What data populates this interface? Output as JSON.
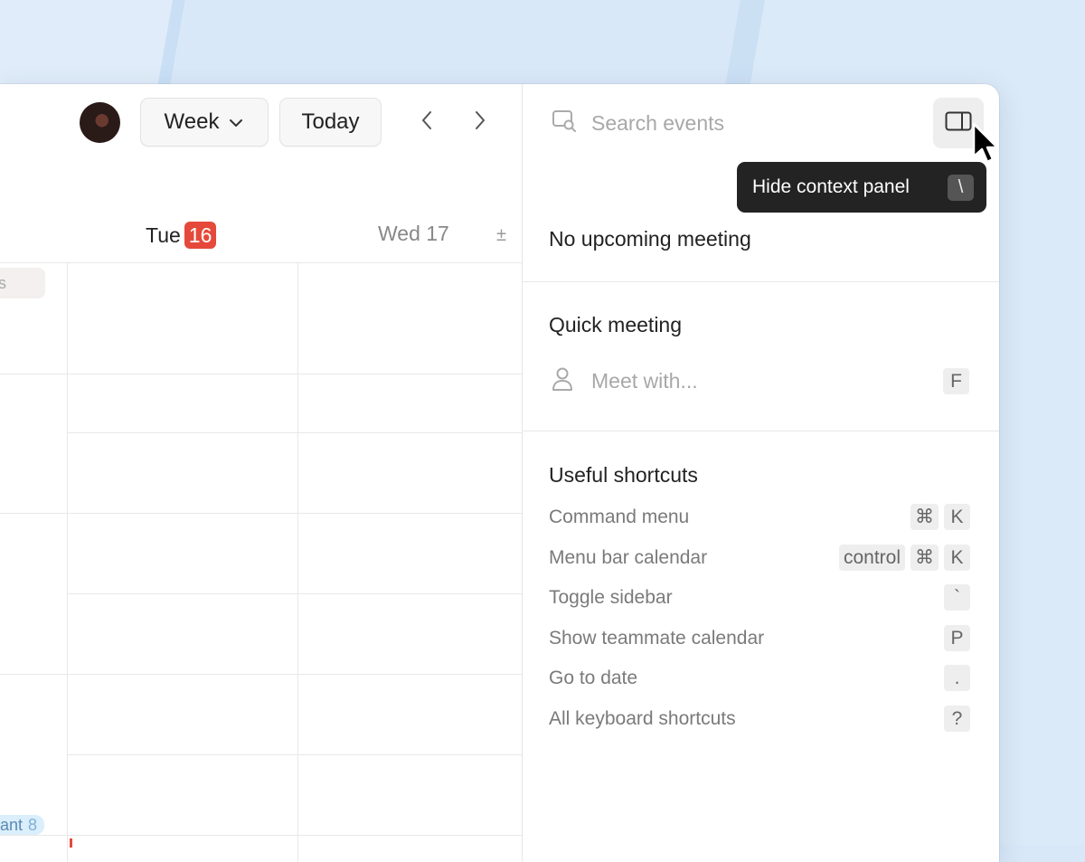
{
  "toolbar": {
    "view_label": "Week",
    "today_label": "Today"
  },
  "days": [
    {
      "name": "Tue",
      "number": "16",
      "is_today": true
    },
    {
      "name": "Wed",
      "number": "17",
      "is_today": false
    }
  ],
  "day_header": {
    "wed_label": "Wed 17",
    "tz_symbol": "±"
  },
  "calendar_events": {
    "top_chip_text": "s",
    "bottom_chip_text": "ant",
    "bottom_chip_count": "8"
  },
  "panel": {
    "search_placeholder": "Search events",
    "tooltip_label": "Hide context panel",
    "tooltip_key": "\\",
    "upcoming_heading": "No upcoming meeting",
    "quick_heading": "Quick meeting",
    "meet_placeholder": "Meet with...",
    "meet_key": "F",
    "shortcuts_heading": "Useful shortcuts",
    "shortcuts": [
      {
        "label": "Command menu",
        "keys": [
          "⌘",
          "K"
        ]
      },
      {
        "label": "Menu bar calendar",
        "keys": [
          "control",
          "⌘",
          "K"
        ]
      },
      {
        "label": "Toggle sidebar",
        "keys": [
          "`"
        ]
      },
      {
        "label": "Show teammate calendar",
        "keys": [
          "P"
        ]
      },
      {
        "label": "Go to date",
        "keys": [
          "."
        ]
      },
      {
        "label": "All keyboard shortcuts",
        "keys": [
          "?"
        ]
      }
    ]
  },
  "colors": {
    "today_badge": "#e5493b",
    "tooltip_bg": "#232323",
    "background": "#d8e8f8"
  },
  "icons": [
    "chevron-down-icon",
    "chevron-left-icon",
    "chevron-right-icon",
    "search-calendar-icon",
    "sidebar-panel-icon",
    "person-icon",
    "mouse-cursor-icon"
  ]
}
